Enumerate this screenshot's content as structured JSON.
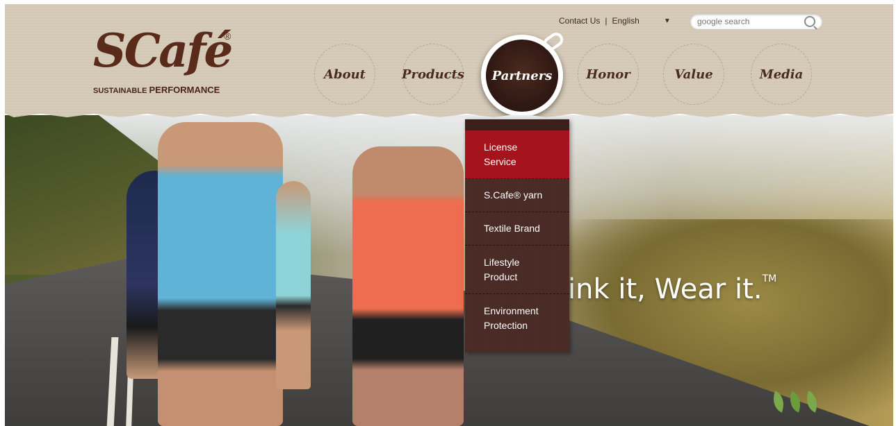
{
  "top_links": {
    "contact": "Contact Us",
    "separator": "|",
    "language": "English",
    "lang_arrow": "▼"
  },
  "search": {
    "placeholder": "google search"
  },
  "logo": {
    "main": "SCafé",
    "reg": "®",
    "sub_small": "SUSTAINABLE",
    "sub_big": "PERFORMANCE"
  },
  "nav": {
    "items": [
      {
        "label": "About"
      },
      {
        "label": "Products"
      },
      {
        "label": "Partners",
        "active": true
      },
      {
        "label": "Honor"
      },
      {
        "label": "Value"
      },
      {
        "label": "Media"
      }
    ]
  },
  "dropdown": {
    "items": [
      {
        "label": "License Service",
        "active": true
      },
      {
        "label": "S.Cafe® yarn"
      },
      {
        "label": "Textile Brand"
      },
      {
        "label": "Lifestyle Product"
      },
      {
        "label": "Environment Protection"
      }
    ]
  },
  "hero": {
    "tagline": "ink it, Wear it.",
    "tm": "TM"
  },
  "colors": {
    "brand_brown": "#5a2a1a",
    "dropdown_bg": "#4b2c26",
    "active_red": "#a5141d",
    "leaf_green": "#7aa84a"
  }
}
